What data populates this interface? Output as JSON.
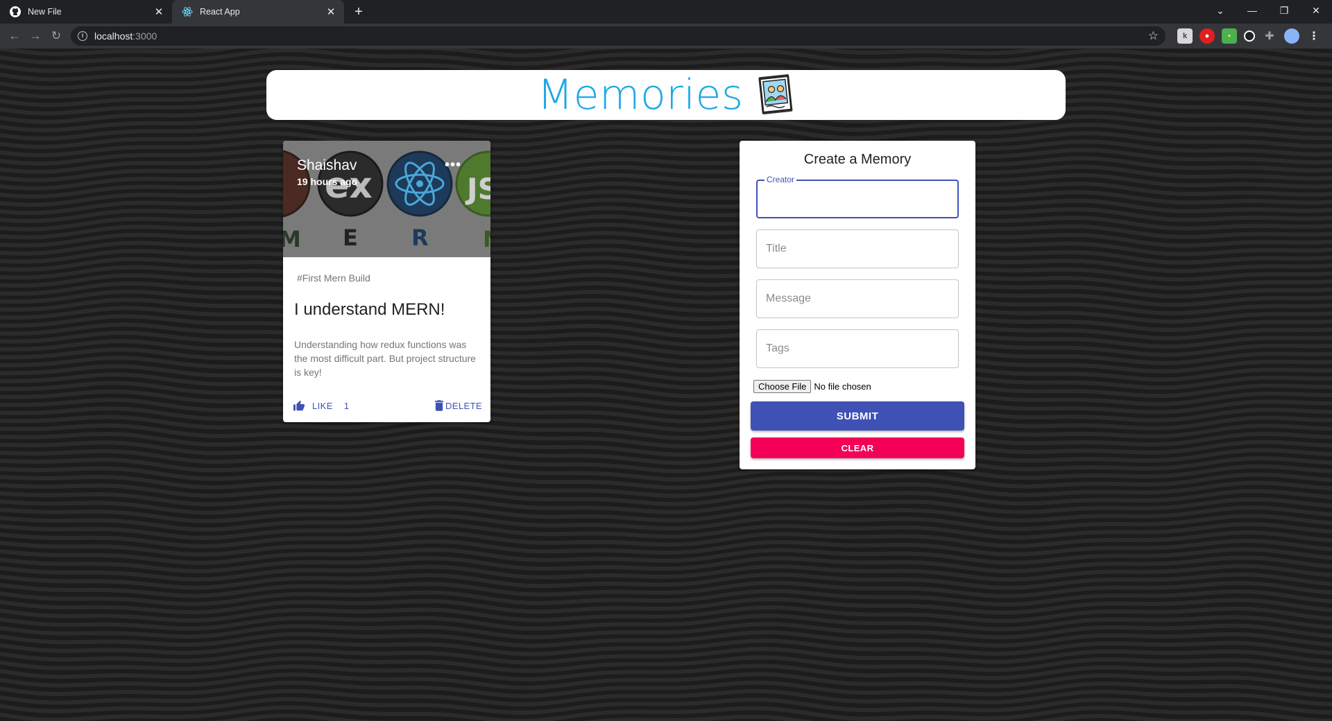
{
  "browser": {
    "tabs": [
      {
        "title": "New File",
        "icon": "github-icon",
        "active": false
      },
      {
        "title": "React App",
        "icon": "react-icon",
        "active": true
      }
    ],
    "url_host": "localhost",
    "url_port": ":3000"
  },
  "app": {
    "title": "Memories",
    "accent_color": "#1ea8e6"
  },
  "post": {
    "creator": "Shaishav",
    "time": "19 hours ago",
    "tags": "#First Mern Build",
    "title": "I understand MERN!",
    "message": "Understanding how redux functions was the most difficult part. But project structure is key!",
    "like_label": "LIKE",
    "like_count": "1",
    "delete_label": "DELETE",
    "more_label": "•••",
    "image_letters": [
      "E",
      "R"
    ]
  },
  "form": {
    "heading": "Create a Memory",
    "creator_label": "Creator",
    "title_placeholder": "Title",
    "message_placeholder": "Message",
    "tags_placeholder": "Tags",
    "file_button": "Choose File",
    "file_status": "No file chosen",
    "submit_label": "SUBMIT",
    "clear_label": "CLEAR",
    "primary_color": "#3f51b5",
    "secondary_color": "#f50057"
  }
}
